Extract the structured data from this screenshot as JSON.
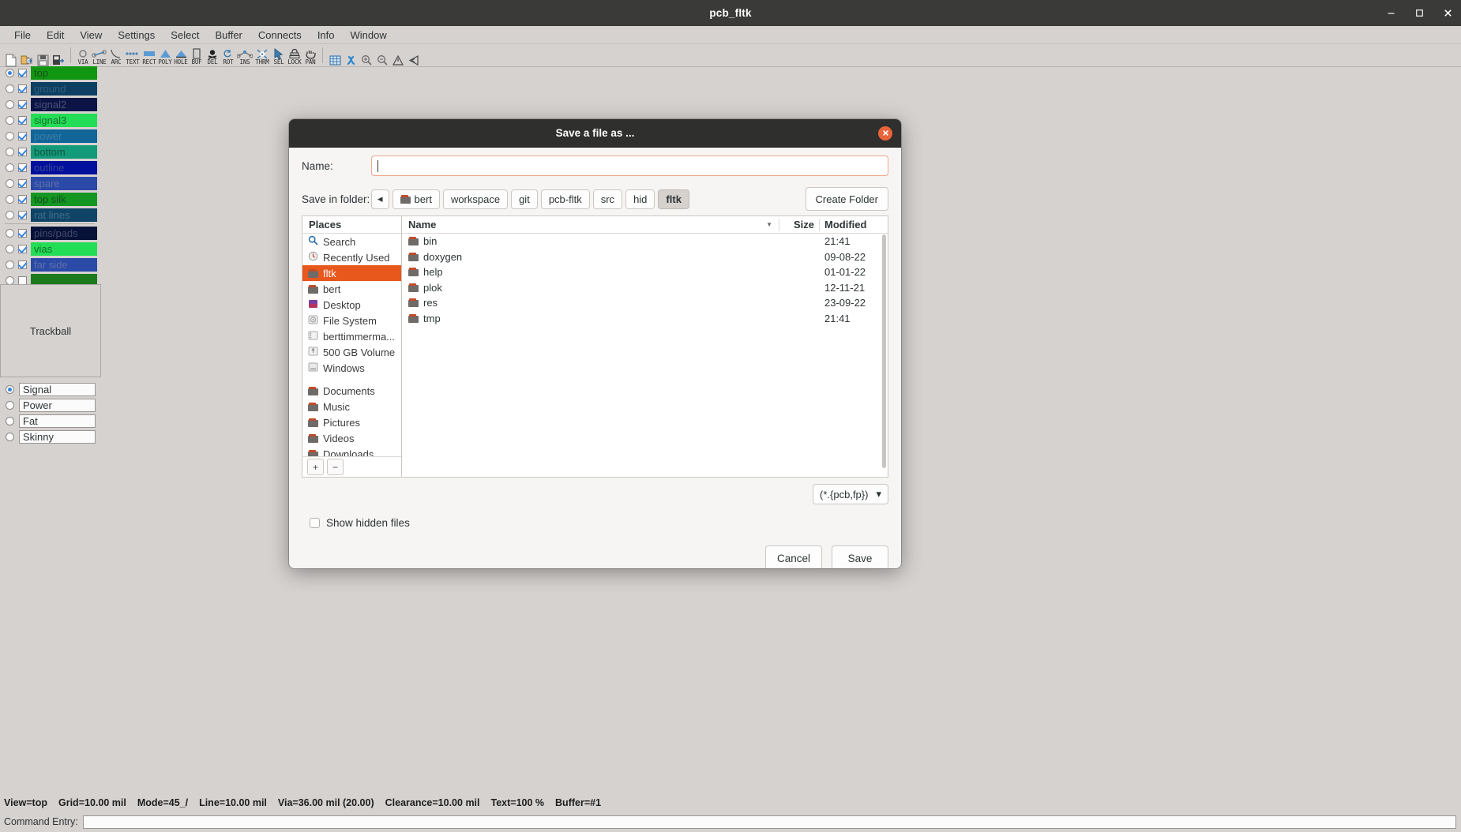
{
  "window": {
    "title": "pcb_fltk",
    "buttons": [
      {
        "name": "minimize-button",
        "glyph": "–"
      },
      {
        "name": "maximize-button",
        "glyph": "□"
      },
      {
        "name": "close-button",
        "glyph": "✕"
      }
    ]
  },
  "menubar": {
    "items": [
      "File",
      "Edit",
      "View",
      "Settings",
      "Select",
      "Buffer",
      "Connects",
      "Info",
      "Window"
    ]
  },
  "toolbar": {
    "file_tools": [
      "new-file-icon",
      "open-file-icon",
      "save-file-icon",
      "save-as-icon"
    ],
    "mode_tools": [
      {
        "icon": "via-icon",
        "label": "VIA"
      },
      {
        "icon": "line-icon",
        "label": "LINE"
      },
      {
        "icon": "arc-icon",
        "label": "ARC"
      },
      {
        "icon": "text-icon",
        "label": "TEXT"
      },
      {
        "icon": "rect-icon",
        "label": "RECT"
      },
      {
        "icon": "poly-icon",
        "label": "POLY"
      },
      {
        "icon": "hole-icon",
        "label": "HOLE"
      },
      {
        "icon": "buffer-icon",
        "label": "BUF"
      },
      {
        "icon": "delete-icon",
        "label": "DEL"
      },
      {
        "icon": "rotate-icon",
        "label": "ROT"
      },
      {
        "icon": "insert-point-icon",
        "label": "INS"
      },
      {
        "icon": "thermal-icon",
        "label": "THRM"
      },
      {
        "icon": "select-icon",
        "label": "SEL"
      },
      {
        "icon": "lock-icon",
        "label": "LOCK"
      },
      {
        "icon": "pan-icon",
        "label": "PAN"
      }
    ],
    "view_tools": [
      "grid-icon",
      "swap-sides-icon",
      "zoom-in-icon",
      "zoom-out-icon",
      "warn-icon",
      "shortcut-icon"
    ]
  },
  "layers": {
    "items": [
      {
        "name": "top",
        "color": "#119611",
        "text_color": "#1d4d1d",
        "checked": true,
        "active": true
      },
      {
        "name": "ground",
        "color": "#0d3f63",
        "text_color": "#2f5f7c",
        "checked": true,
        "active": false
      },
      {
        "name": "signal2",
        "color": "#0b1445",
        "text_color": "#4a5276",
        "checked": true,
        "active": false
      },
      {
        "name": "signal3",
        "color": "#22dd55",
        "text_color": "#1c6b2e",
        "checked": true,
        "active": false
      },
      {
        "name": "power",
        "color": "#126598",
        "text_color": "#3b7fa8",
        "checked": true,
        "active": false
      },
      {
        "name": "bottom",
        "color": "#139a78",
        "text_color": "#12563f",
        "checked": true,
        "active": false
      },
      {
        "name": "outline",
        "color": "#000f9c",
        "text_color": "#3a4797",
        "checked": true,
        "active": false
      },
      {
        "name": "spare",
        "color": "#2b49a6",
        "text_color": "#5f72ac",
        "checked": true,
        "active": false
      },
      {
        "name": "top silk",
        "color": "#139622",
        "text_color": "#15521f",
        "checked": true,
        "active": false
      },
      {
        "name": "rat lines",
        "color": "#104466",
        "text_color": "#3e6d88",
        "checked": true,
        "active": false,
        "sep_after": true
      },
      {
        "name": "pins/pads",
        "color": "#071238",
        "text_color": "#42496b",
        "checked": true,
        "active": false
      },
      {
        "name": "vias",
        "color": "#22dd55",
        "text_color": "#176b2c",
        "checked": true,
        "active": false
      },
      {
        "name": "far side",
        "color": "#2b49a6",
        "text_color": "#5f72ac",
        "checked": true,
        "active": false
      },
      {
        "name": "",
        "color": "#1c7a1c",
        "text_color": "#1c7a1c",
        "checked": false,
        "active": false
      }
    ]
  },
  "trackball": {
    "label": "Trackball"
  },
  "route_styles": {
    "items": [
      {
        "label": "Signal",
        "selected": true
      },
      {
        "label": "Power",
        "selected": false
      },
      {
        "label": "Fat",
        "selected": false
      },
      {
        "label": "Skinny",
        "selected": false
      }
    ]
  },
  "status": {
    "fields": [
      "View=top",
      "Grid=10.00 mil",
      "Mode=45_/",
      "Line=10.00 mil",
      "Via=36.00 mil (20.00)",
      "Clearance=10.00 mil",
      "Text=100 %",
      "Buffer=#1"
    ]
  },
  "command": {
    "label": "Command Entry:",
    "value": ""
  },
  "dialog": {
    "title": "Save a file as ...",
    "close_icon": "✕",
    "name_label": "Name:",
    "name_value": "",
    "name_placeholder": "",
    "folder_label": "Save in folder:",
    "back_glyph": "◂",
    "crumbs": [
      {
        "label": "bert",
        "icon": "folder-icon",
        "selected": false
      },
      {
        "label": "workspace",
        "selected": false
      },
      {
        "label": "git",
        "selected": false
      },
      {
        "label": "pcb-fltk",
        "selected": false
      },
      {
        "label": "src",
        "selected": false
      },
      {
        "label": "hid",
        "selected": false
      },
      {
        "label": "fltk",
        "selected": true
      }
    ],
    "create_folder_label": "Create Folder",
    "places_header": "Places",
    "places": [
      {
        "label": "Search",
        "icon": "search-icon",
        "selected": false
      },
      {
        "label": "Recently Used",
        "icon": "recent-icon",
        "selected": false
      },
      {
        "label": "fltk",
        "icon": "folder-icon",
        "selected": true
      },
      {
        "label": "bert",
        "icon": "folder-icon",
        "selected": false
      },
      {
        "label": "Desktop",
        "icon": "desktop-icon",
        "selected": false
      },
      {
        "label": "File System",
        "icon": "disk-icon",
        "selected": false
      },
      {
        "label": "berttimmerma...",
        "icon": "drive-icon",
        "selected": false
      },
      {
        "label": "500 GB Volume",
        "icon": "volume-icon",
        "selected": false
      },
      {
        "label": "Windows",
        "icon": "windows-icon",
        "selected": false
      },
      {
        "label": "Documents",
        "icon": "folder-icon",
        "selected": false,
        "group_start": true
      },
      {
        "label": "Music",
        "icon": "folder-icon",
        "selected": false
      },
      {
        "label": "Pictures",
        "icon": "folder-icon",
        "selected": false
      },
      {
        "label": "Videos",
        "icon": "folder-icon",
        "selected": false
      },
      {
        "label": "Downloads",
        "icon": "folder-icon",
        "selected": false
      }
    ],
    "places_add": "+",
    "places_remove": "−",
    "columns": {
      "name": "Name",
      "size": "Size",
      "modified": "Modified",
      "sort_glyph": "▼"
    },
    "files": [
      {
        "name": "bin",
        "size": "",
        "modified": "21:41"
      },
      {
        "name": "doxygen",
        "size": "",
        "modified": "09-08-22"
      },
      {
        "name": "help",
        "size": "",
        "modified": "01-01-22"
      },
      {
        "name": "plok",
        "size": "",
        "modified": "12-11-21"
      },
      {
        "name": "res",
        "size": "",
        "modified": "23-09-22"
      },
      {
        "name": "tmp",
        "size": "",
        "modified": "21:41"
      }
    ],
    "filter_label": "(*.{pcb,fp})",
    "filter_arrow": "▾",
    "show_hidden_label": "Show hidden files",
    "show_hidden_checked": false,
    "cancel_label": "Cancel",
    "save_label": "Save"
  },
  "colors": {
    "accent": "#e8571c",
    "dialog_title_bg": "#2f2f2d",
    "dialog_bg": "#f6f5f4",
    "window_chrome": "#d6d2d0",
    "focus_border": "#f0a68a"
  }
}
